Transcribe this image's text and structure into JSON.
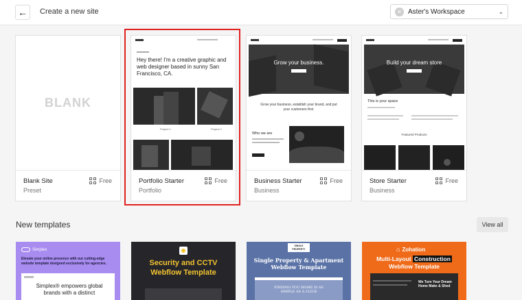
{
  "header": {
    "back_icon": "arrow-left-icon",
    "title": "Create a new site",
    "workspace_name": "Aster's Workspace",
    "workspace_icon": "circle-x-icon",
    "chevron_icon": "chevron-down-icon"
  },
  "sites": [
    {
      "thumb_text": "BLANK",
      "name": "Blank Site",
      "subtitle": "Preset",
      "price": "Free"
    },
    {
      "name": "Portfolio Starter",
      "subtitle": "Portfolio",
      "price": "Free",
      "heading": "Hey there! I'm a creative graphic and web designer based in sunny San Francisco, CA.",
      "brand": "Portfolio",
      "project1": "Project 1",
      "project2": "Project 2"
    },
    {
      "name": "Business Starter",
      "subtitle": "Business",
      "price": "Free",
      "heading": "Grow your business.",
      "body": "Grow your business, establish your brand, and put your customers first.",
      "who": "Who we are",
      "brand": "Business"
    },
    {
      "name": "Store Starter",
      "subtitle": "Business",
      "price": "Free",
      "heading": "Build your dream store",
      "space": "This is your space",
      "featured": "Featured Products",
      "brand": "Store"
    }
  ],
  "new_templates": {
    "title": "New templates",
    "view_all": "View all",
    "items": [
      {
        "logo": "Simplex",
        "tagline": "Elevate your online presence with our cutting-edge website template designed exclusively for agencies.",
        "headline": "Simplex® empowers global brands with a distinct"
      },
      {
        "headline": "Security and CCTV Webflow Template"
      },
      {
        "badge": "SINGLE PROPERTY",
        "headline": "Single Property & Apartment Webflow Template",
        "sub": "FINDING YOU HOME IS AS SIMPLE AS A CLICK"
      },
      {
        "logo": "Zohation",
        "headline_a": "Multi-Layout",
        "headline_b": "Construction",
        "headline_c": "Webflow Template",
        "sub": "We Turn Your Dream Home Make & Shed"
      }
    ]
  },
  "colors": {
    "selection": "#e0201f",
    "accent_yellow": "#f4c430",
    "orange": "#f06b19",
    "purple": "#a98cf0",
    "navy": "#5a72a6"
  }
}
